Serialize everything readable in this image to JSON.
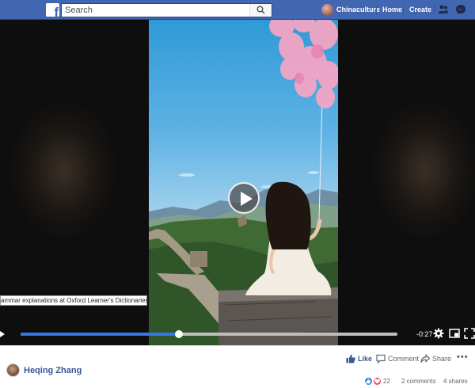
{
  "topbar": {
    "search_placeholder": "Search",
    "profile_name": "Chinaculture",
    "home_label": "Home",
    "create_label": "Create",
    "logo_glyph": "f"
  },
  "video": {
    "caption": "ammar explanations at Oxford Learner's Dictionaries",
    "time_remaining": "-0:27",
    "progress": 0.42
  },
  "post": {
    "author": "Heqing Zhang",
    "like_label": "Like",
    "comment_label": "Comment",
    "share_label": "Share",
    "reaction_count": "22",
    "comments": "2 comments",
    "shares": "4 shares"
  },
  "colors": {
    "brand": "#4267b2",
    "progress": "#3578e5",
    "link": "#385898"
  }
}
